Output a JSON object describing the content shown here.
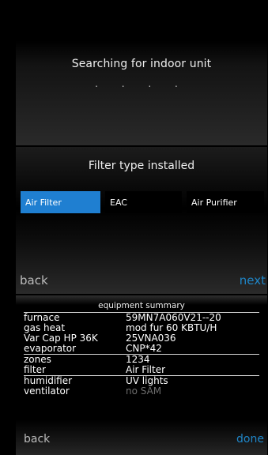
{
  "searching": {
    "title": "Searching for indoor unit",
    "dots": ". . . ."
  },
  "filter_type": {
    "title": "Filter type installed",
    "options": [
      "Air Filter",
      "EAC",
      "Air Purifier"
    ],
    "selected": "Air Filter",
    "back_label": "back",
    "next_label": "next"
  },
  "equipment_summary": {
    "title": "equipment summary",
    "rows": [
      {
        "label": "furnace",
        "value": "59MN7A060V21--20"
      },
      {
        "label": "gas heat",
        "value": "mod fur 60 KBTU/H"
      },
      {
        "label": "Var Cap HP 36K",
        "value": "25VNA036"
      },
      {
        "label": "evaporator",
        "value": "CNP*42"
      },
      {
        "label": "zones",
        "value": "1234"
      },
      {
        "label": "filter",
        "value": "Air Filter"
      },
      {
        "label": "humidifier",
        "value": "UV lights"
      },
      {
        "label": "ventilator",
        "value": "no SAM"
      }
    ],
    "back_label": "back",
    "done_label": "done"
  },
  "colors": {
    "accent": "#1f7fd1",
    "link": "#1f86c8",
    "muted": "#bcbcbc"
  }
}
